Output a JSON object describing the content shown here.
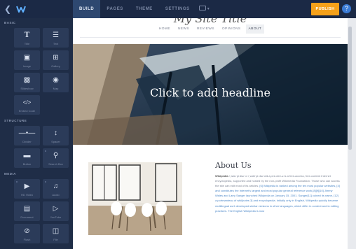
{
  "topbar": {
    "tabs": [
      {
        "label": "BUILD",
        "active": true
      },
      {
        "label": "PAGES",
        "active": false
      },
      {
        "label": "THEME",
        "active": false
      },
      {
        "label": "SETTINGS",
        "active": false
      }
    ],
    "device_icon": "monitor-icon",
    "publish_label": "PUBLISH",
    "help_icon": "help-icon",
    "back_icon": "back-chevron-icon",
    "logo_icon": "weebly-logo-icon",
    "accent_color": "#f5a11a"
  },
  "sidebar": {
    "sections": [
      {
        "title": "BASIC",
        "items": [
          {
            "label": "Title",
            "icon": "title-icon"
          },
          {
            "label": "Text",
            "icon": "text-icon"
          },
          {
            "label": "Image",
            "icon": "image-icon"
          },
          {
            "label": "Gallery",
            "icon": "gallery-icon"
          },
          {
            "label": "Slideshow",
            "icon": "slideshow-icon"
          },
          {
            "label": "Map",
            "icon": "map-icon"
          },
          {
            "label": "Embed Code",
            "icon": "embed-code-icon"
          }
        ]
      },
      {
        "title": "STRUCTURE",
        "items": [
          {
            "label": "Divider",
            "icon": "divider-icon"
          },
          {
            "label": "Spacer",
            "icon": "spacer-icon"
          },
          {
            "label": "Button",
            "icon": "button-icon"
          },
          {
            "label": "Search Box",
            "icon": "search-icon"
          }
        ]
      },
      {
        "title": "MEDIA",
        "items": [
          {
            "label": "HD Video",
            "icon": "video-icon"
          },
          {
            "label": "Audio",
            "icon": "audio-icon"
          },
          {
            "label": "Document",
            "icon": "document-icon"
          },
          {
            "label": "YouTube",
            "icon": "youtube-icon"
          },
          {
            "label": "Flash",
            "icon": "flash-icon"
          },
          {
            "label": "File",
            "icon": "file-icon"
          }
        ]
      }
    ]
  },
  "site": {
    "title": "My Site Title",
    "nav": [
      {
        "label": "HOME",
        "active": false
      },
      {
        "label": "NEWS",
        "active": false
      },
      {
        "label": "REVIEWS",
        "active": false
      },
      {
        "label": "OPINIONS",
        "active": false
      },
      {
        "label": "ABOUT",
        "active": true
      }
    ],
    "hero_headline": "Click to add headline",
    "about": {
      "title": "About Us",
      "p1_bold": "Wikipedia",
      "p1_rest": " /ˌwɪkᵻˈpiːdiə/ or /ˌwɪkiˈpiːdiə/ wik-i-pee-dee-ə is a free-access, free-content Internet encyclopedia, supported and hosted by the non-profit Wikimedia Foundation. Those who can access the site can edit most of its articles.",
      "p2": "[6] Wikipedia is ranked among the ten most popular websites, [4] and constitutes the Internet's largest and most popular general reference work.[8][9][10]",
      "p3": "Jimmy Wales and Larry Sanger launched Wikipedia on January 15, 2001. Sanger[11] coined its name,",
      "p4": "[12] a portmanteau of wiki[notes 3] and encyclopedia. Initially only in English, Wikipedia quickly became multilingual as it developed similar versions in other languages, which differ in content and in editing practices. The English Wikipedia is now"
    }
  }
}
